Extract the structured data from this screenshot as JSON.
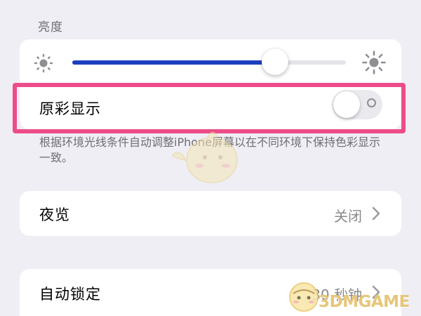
{
  "brightness": {
    "header": "亮度",
    "level": 0.74,
    "fill_color": "#1c3fbf",
    "low_icon": "sun-small-icon",
    "high_icon": "sun-large-icon"
  },
  "true_tone": {
    "label": "原彩显示",
    "toggle_on": false,
    "highlight_color": "#ec4d88",
    "footnote": "根据环境光线条件自动调整iPhone屏幕以在不同环境下保持色彩显示一致。"
  },
  "night_shift": {
    "label": "夜览",
    "value": "关闭",
    "chevron_icon": "chevron-right-icon"
  },
  "auto_lock": {
    "label": "自动锁定",
    "value": "30 秒钟",
    "chevron_icon": "chevron-right-icon"
  },
  "watermark": {
    "text": "3DMGAME",
    "color": "#e7c67a"
  }
}
